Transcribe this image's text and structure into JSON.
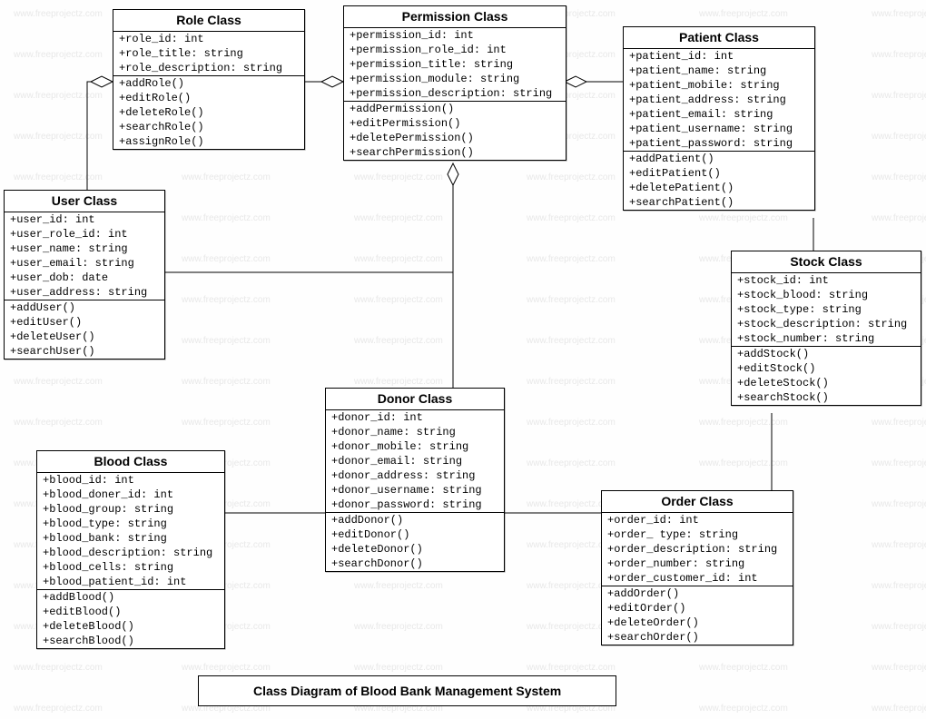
{
  "caption": "Class Diagram of Blood Bank Management System",
  "watermark": "www.freeprojectz.com",
  "classes": {
    "role": {
      "title": "Role Class",
      "attrs": [
        "+role_id: int",
        "+role_title: string",
        "+role_description: string"
      ],
      "ops": [
        "+addRole()",
        "+editRole()",
        "+deleteRole()",
        "+searchRole()",
        "+assignRole()"
      ]
    },
    "permission": {
      "title": "Permission Class",
      "attrs": [
        "+permission_id: int",
        "+permission_role_id: int",
        "+permission_title: string",
        "+permission_module: string",
        "+permission_description: string"
      ],
      "ops": [
        "+addPermission()",
        "+editPermission()",
        "+deletePermission()",
        "+searchPermission()"
      ]
    },
    "patient": {
      "title": "Patient Class",
      "attrs": [
        "+patient_id: int",
        "+patient_name: string",
        "+patient_mobile: string",
        "+patient_address: string",
        "+patient_email: string",
        "+patient_username: string",
        "+patient_password: string"
      ],
      "ops": [
        "+addPatient()",
        "+editPatient()",
        "+deletePatient()",
        "+searchPatient()"
      ]
    },
    "user": {
      "title": "User Class",
      "attrs": [
        "+user_id: int",
        "+user_role_id: int",
        "+user_name: string",
        "+user_email: string",
        "+user_dob: date",
        "+user_address: string"
      ],
      "ops": [
        "+addUser()",
        "+editUser()",
        "+deleteUser()",
        "+searchUser()"
      ]
    },
    "stock": {
      "title": "Stock Class",
      "attrs": [
        "+stock_id: int",
        "+stock_blood: string",
        "+stock_type: string",
        "+stock_description: string",
        "+stock_number: string"
      ],
      "ops": [
        "+addStock()",
        "+editStock()",
        "+deleteStock()",
        "+searchStock()"
      ]
    },
    "donor": {
      "title": "Donor Class",
      "attrs": [
        "+donor_id: int",
        "+donor_name: string",
        "+donor_mobile: string",
        "+donor_email: string",
        "+donor_address: string",
        "+donor_username: string",
        "+donor_password: string"
      ],
      "ops": [
        "+addDonor()",
        "+editDonor()",
        "+deleteDonor()",
        "+searchDonor()"
      ]
    },
    "blood": {
      "title": "Blood Class",
      "attrs": [
        "+blood_id: int",
        "+blood_doner_id: int",
        "+blood_group: string",
        "+blood_type: string",
        "+blood_bank: string",
        "+blood_description: string",
        "+blood_cells: string",
        "+blood_patient_id: int"
      ],
      "ops": [
        "+addBlood()",
        "+editBlood()",
        "+deleteBlood()",
        "+searchBlood()"
      ]
    },
    "order": {
      "title": "Order Class",
      "attrs": [
        "+order_id: int",
        "+order_ type: string",
        "+order_description: string",
        "+order_number: string",
        "+order_customer_id: int"
      ],
      "ops": [
        "+addOrder()",
        "+editOrder()",
        "+deleteOrder()",
        "+searchOrder()"
      ]
    }
  }
}
